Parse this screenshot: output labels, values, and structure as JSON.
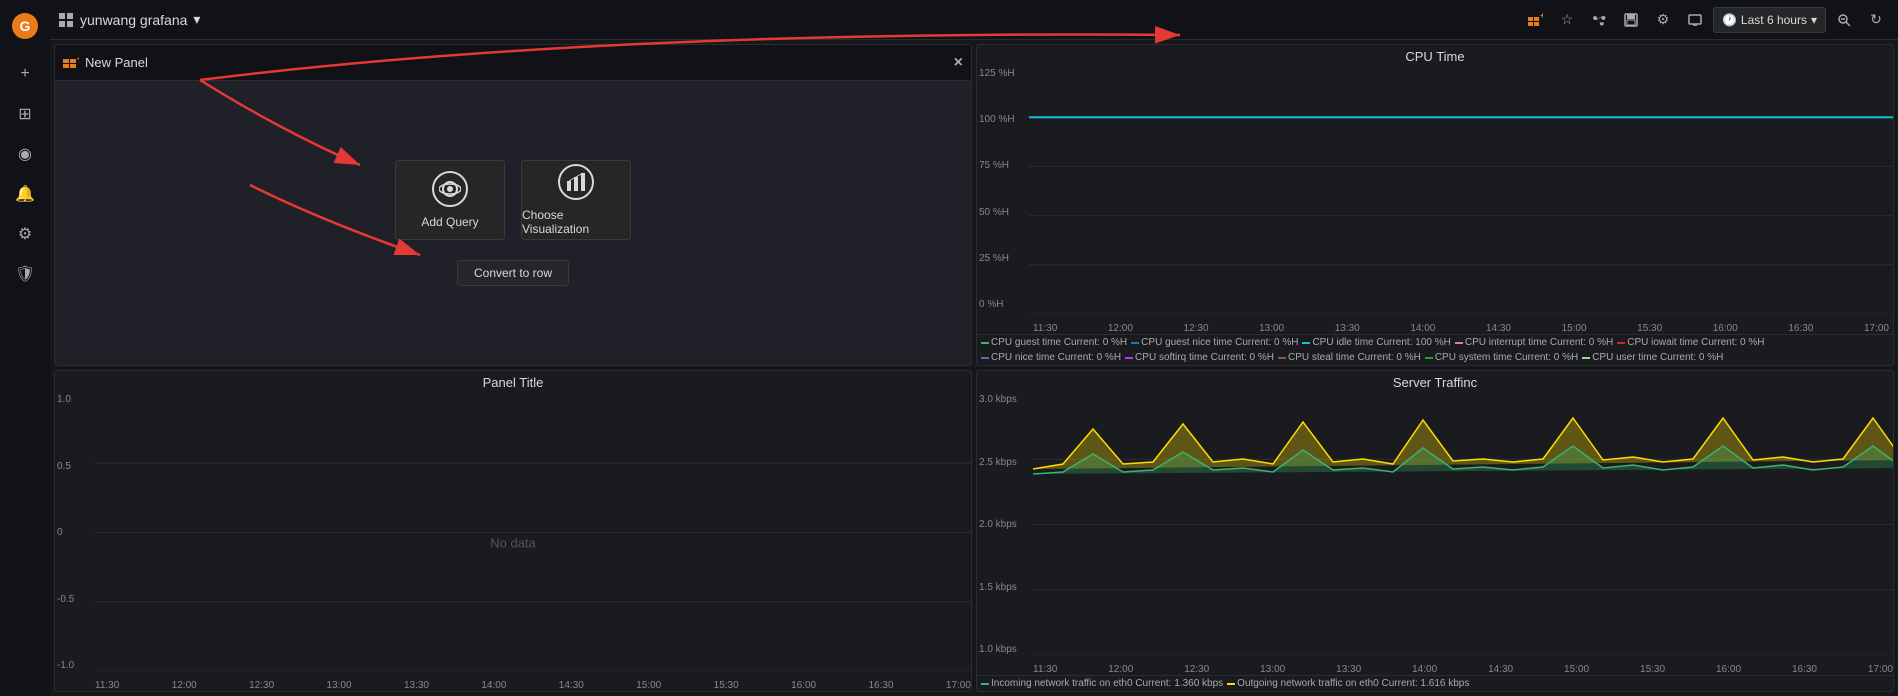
{
  "sidebar": {
    "logo": "🔥",
    "items": [
      {
        "name": "add-icon",
        "icon": "+",
        "label": "Add"
      },
      {
        "name": "dashboard-icon",
        "icon": "⊞",
        "label": "Dashboards"
      },
      {
        "name": "explore-icon",
        "icon": "◎",
        "label": "Explore"
      },
      {
        "name": "alert-icon",
        "icon": "🔔",
        "label": "Alerting"
      },
      {
        "name": "settings-icon",
        "icon": "⚙",
        "label": "Settings"
      },
      {
        "name": "shield-icon",
        "icon": "🛡",
        "label": "Shield"
      }
    ]
  },
  "topbar": {
    "workspace": "yunwang grafana",
    "workspace_dropdown": "▾",
    "actions": {
      "add_panel": "📊+",
      "star": "☆",
      "share": "⬆",
      "save": "💾",
      "settings": "⚙",
      "tv": "📺",
      "time_picker": "Last 6 hours",
      "zoom_out": "🔍",
      "refresh": "↻"
    }
  },
  "new_panel": {
    "title": "New Panel",
    "close": "×",
    "add_query_label": "Add Query",
    "choose_viz_label": "Choose Visualization",
    "convert_row_label": "Convert to row"
  },
  "panels": {
    "cpu_time": {
      "title": "CPU Time",
      "y_labels": [
        "125 %H",
        "100 %H",
        "75 %H",
        "50 %H",
        "25 %H",
        "0 %H"
      ],
      "x_labels": [
        "11:30",
        "12:00",
        "12:30",
        "13:00",
        "13:30",
        "14:00",
        "14:30",
        "15:00",
        "15:30",
        "16:00",
        "16:30",
        "17:00"
      ],
      "legend": [
        {
          "color": "#3cb371",
          "text": "CPU guest time  Current: 0 %H"
        },
        {
          "color": "#1f77b4",
          "text": "CPU guest nice time  Current: 0 %H"
        },
        {
          "color": "#17becf",
          "text": "CPU idle time  Current: 100 %H"
        },
        {
          "color": "#e377c2",
          "text": "CPU interrupt time  Current: 0 %H"
        },
        {
          "color": "#d62728",
          "text": "CPU iowait time  Current: 0 %H"
        },
        {
          "color": "#4c78a8",
          "text": "CPU nice time  Current: 0 %H"
        },
        {
          "color": "#aa40fc",
          "text": "CPU softirq time  Current: 0 %H"
        },
        {
          "color": "#8c564b",
          "text": "CPU steal time  Current: 0 %H"
        },
        {
          "color": "#2ca02c",
          "text": "CPU system time  Current: 0 %H"
        },
        {
          "color": "#98df8a",
          "text": "CPU user time  Current: 0 %H"
        }
      ]
    },
    "panel_title": {
      "title": "Panel Title",
      "y_labels": [
        "1.0",
        "0.5",
        "0",
        "-0.5",
        "-1.0"
      ],
      "x_labels": [
        "11:30",
        "12:00",
        "12:30",
        "13:00",
        "13:30",
        "14:00",
        "14:30",
        "15:00",
        "15:30",
        "16:00",
        "16:30",
        "17:00"
      ],
      "no_data": "No data"
    },
    "server_traffic": {
      "title": "Server Traffinc",
      "y_labels": [
        "3.0 kbps",
        "2.5 kbps",
        "2.0 kbps",
        "1.5 kbps",
        "1.0 kbps"
      ],
      "x_labels": [
        "11:30",
        "12:00",
        "12:30",
        "13:00",
        "13:30",
        "14:00",
        "14:30",
        "15:00",
        "15:30",
        "16:00",
        "16:30",
        "17:00"
      ],
      "legend": [
        {
          "color": "#3cb371",
          "text": "Incoming network traffic on eth0  Current: 1.360 kbps"
        },
        {
          "color": "#ffdd00",
          "text": "Outgoing network traffic on eth0  Current: 1.616 kbps"
        }
      ]
    }
  }
}
